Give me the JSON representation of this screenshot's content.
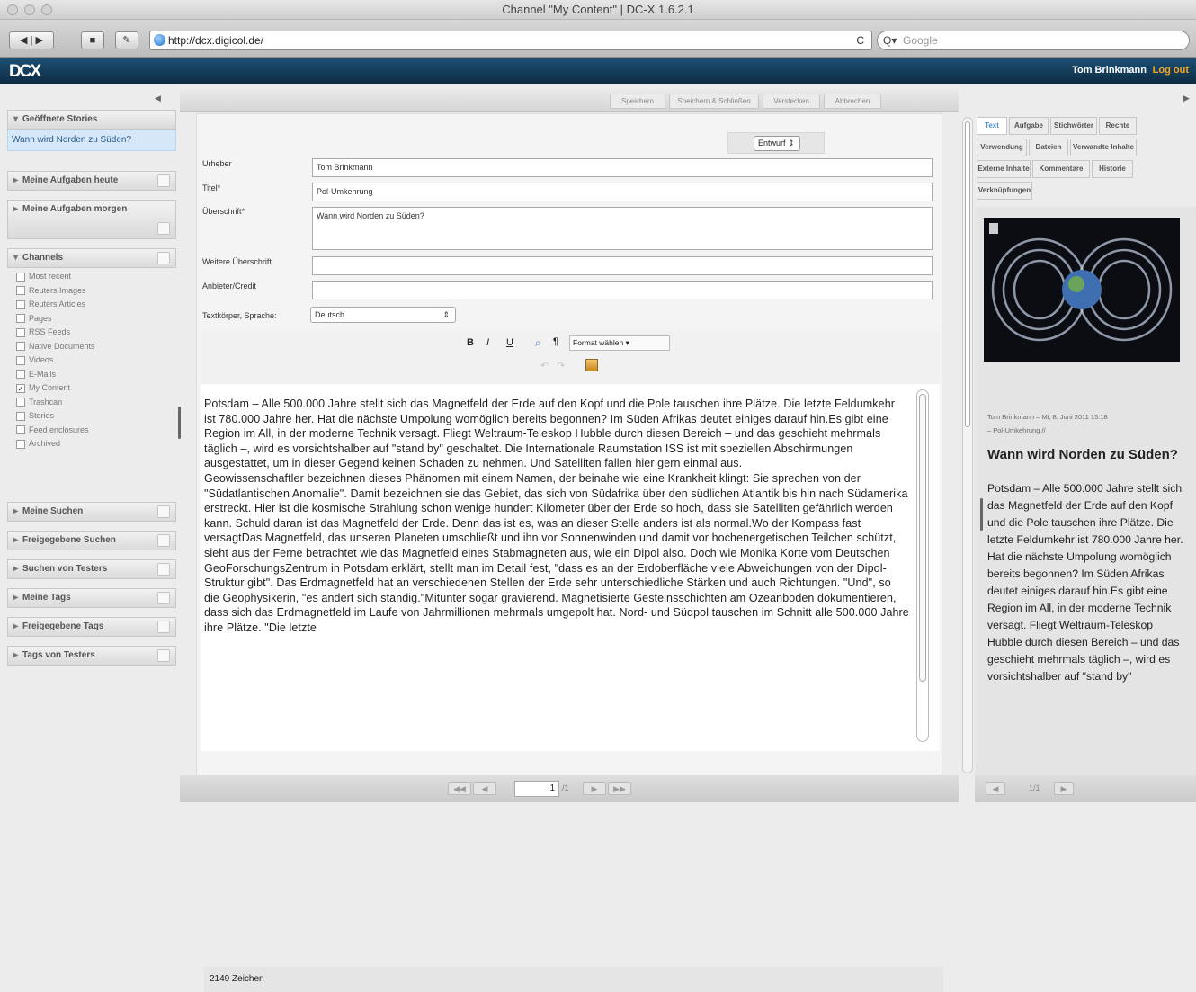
{
  "window": {
    "title": "Channel \"My Content\" | DC-X 1.6.2.1"
  },
  "browser": {
    "url": "http://dcx.digicol.de/",
    "search_placeholder": "Google",
    "reload": "C",
    "search_prefix": "Q▾"
  },
  "app": {
    "logo": "DCX",
    "user": "Tom Brinkmann",
    "logout": "Log out"
  },
  "left": {
    "open_stories_header": "Geöffnete Stories",
    "open_story": "Wann wird Norden zu Süden?",
    "tasks_today": "Meine Aufgaben heute",
    "tasks_tomorrow": "Meine Aufgaben morgen",
    "channels_header": "Channels",
    "channels": [
      {
        "label": "Most recent",
        "checked": false
      },
      {
        "label": "Reuters Images",
        "checked": false
      },
      {
        "label": "Reuters Articles",
        "checked": false
      },
      {
        "label": "Pages",
        "checked": false
      },
      {
        "label": "RSS Feeds",
        "checked": false
      },
      {
        "label": "Native Documents",
        "checked": false
      },
      {
        "label": "Videos",
        "checked": false
      },
      {
        "label": "E-Mails",
        "checked": false
      },
      {
        "label": "My Content",
        "checked": true
      },
      {
        "label": "Trashcan",
        "checked": false
      },
      {
        "label": "Stories",
        "checked": false
      },
      {
        "label": "Feed enclosures",
        "checked": false
      },
      {
        "label": "Archived",
        "checked": false
      }
    ],
    "sections": [
      "Meine Suchen",
      "Freigegebene Suchen",
      "Suchen von Testers",
      "Meine Tags",
      "Freigegebene Tags",
      "Tags von Testers"
    ]
  },
  "actions": {
    "save": "Speichern",
    "save_close": "Speichern & Schließen",
    "hide": "Verstecken",
    "cancel": "Abbrechen"
  },
  "form": {
    "status": "Entwurf",
    "author_label": "Urheber",
    "author_value": "Tom Brinkmann",
    "title_label": "Titel*",
    "title_value": "Pol-Umkehrung",
    "headline_label": "Überschrift*",
    "headline_value": "Wann wird Norden zu Süden?",
    "subheadline_label": "Weitere Überschrift",
    "subheadline_value": "",
    "credit_label": "Anbieter/Credit",
    "credit_value": "",
    "language_label": "Textkörper, Sprache:",
    "language_value": "Deutsch",
    "format_select": "Format wählen",
    "char_count": "2149 Zeichen",
    "body": "Potsdam – Alle 500.000 Jahre stellt sich das Magnetfeld der Erde auf den Kopf und die Pole tauschen ihre Plätze. Die letzte Feldumkehr ist 780.000 Jahre her. Hat die nächste Umpolung womöglich bereits begonnen? Im Süden Afrikas deutet einiges darauf hin.Es gibt eine Region im All, in der moderne Technik versagt. Fliegt Weltraum-Teleskop Hubble durch diesen Bereich – und das geschieht mehrmals täglich –, wird es vorsichtshalber auf \"stand by\" geschaltet. Die Internationale Raumstation ISS ist mit speziellen Abschirmungen ausgestattet, um in dieser Gegend keinen Schaden zu nehmen. Und Satelliten fallen hier gern einmal aus.\nGeowissenschaftler bezeichnen dieses Phänomen mit einem Namen, der beinahe wie eine Krankheit klingt: Sie sprechen von der \"Südatlantischen Anomalie\". Damit bezeichnen sie das Gebiet, das sich von Südafrika über den südlichen Atlantik bis hin nach Südamerika erstreckt. Hier ist die kosmische Strahlung schon wenige hundert Kilometer über der Erde so hoch, dass sie Satelliten gefährlich werden kann. Schuld daran ist das Magnetfeld der Erde. Denn das ist es, was an dieser Stelle anders ist als normal.Wo der Kompass fast versagtDas Magnetfeld, das unseren Planeten umschließt und ihn vor Sonnenwinden und damit vor hochenergetischen Teilchen schützt, sieht aus der Ferne betrachtet wie das Magnetfeld eines Stabmagneten aus, wie ein Dipol also. Doch wie Monika Korte vom Deutschen GeoForschungsZentrum in Potsdam erklärt, stellt man im Detail fest, \"dass es an der Erdoberfläche viele Abweichungen von der Dipol-Struktur gibt\". Das Erdmagnetfeld hat an verschiedenen Stellen der Erde sehr unterschiedliche Stärken und auch Richtungen. \"Und\", so die Geophysikerin, \"es ändert sich ständig.\"Mitunter sogar gravierend. Magnetisierte Gesteinsschichten am Ozeanboden dokumentieren, dass sich das Erdmagnetfeld im Laufe von Jahrmillionen mehrmals umgepolt hat. Nord- und Südpol tauschen im Schnitt alle 500.000 Jahre ihre Plätze. \"Die letzte"
  },
  "pager": {
    "page": "1",
    "total": "/1"
  },
  "right": {
    "tabs_row1": [
      "Text",
      "Aufgabe",
      "Stichwörter",
      "Rechte"
    ],
    "tabs_row2": [
      "Verwendung",
      "Dateien",
      "Verwandte Inhalte"
    ],
    "tabs_row3": [
      "Externe Inhalte",
      "Kommentare",
      "Historie"
    ],
    "tabs_row4": [
      "Verknüpfungen"
    ],
    "meta": "Tom Brinkmann – Mi, 8. Juni 2011 15:18",
    "meta2": "– Pol-Umkehrung //",
    "headline": "Wann wird Norden zu Süden?",
    "text": "Potsdam – Alle 500.000 Jahre stellt sich das Magnetfeld der Erde auf den Kopf und die Pole tauschen ihre Plätze. Die letzte Feldumkehr ist 780.000 Jahre her. Hat die nächste Umpolung womöglich bereits begonnen? Im Süden Afrikas deutet einiges darauf hin.Es gibt eine Region im All, in der moderne Technik versagt. Fliegt Weltraum-Teleskop Hubble durch diesen Bereich – und das geschieht mehrmals täglich –, wird es vorsichtshalber auf \"stand by\"",
    "pager": "1/1"
  }
}
